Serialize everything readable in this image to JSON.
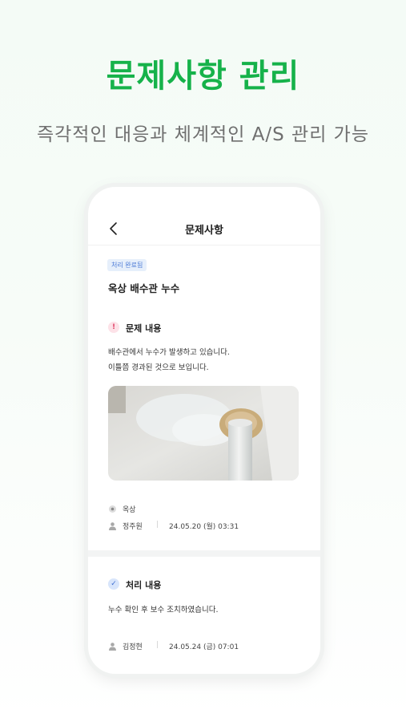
{
  "hero": {
    "title": "문제사항 관리",
    "subtitle": "즉각적인 대응과 체계적인 A/S 관리 가능"
  },
  "screen": {
    "title": "문제사항",
    "back_icon": "chevron-left-icon",
    "badge": "처리 완료됨",
    "issue_title": "옥상 배수관 누수"
  },
  "problem": {
    "heading": "문제 내용",
    "icon": "alert-icon",
    "lines": [
      "배수관에서 누수가 발생하고 있습니다.",
      "이틀쯤 경과된 것으로 보입니다."
    ],
    "location": "옥상",
    "author": "정주원",
    "datetime": "24.05.20 (월) 03:31"
  },
  "resolution": {
    "heading": "처리 내용",
    "icon": "check-icon",
    "text": "누수 확인 후 보수 조치하였습니다.",
    "author": "김정현",
    "datetime": "24.05.24 (금) 07:01"
  },
  "colors": {
    "accent": "#16b24a",
    "badge_text": "#4d7bd6",
    "badge_bg": "#e6effb"
  }
}
